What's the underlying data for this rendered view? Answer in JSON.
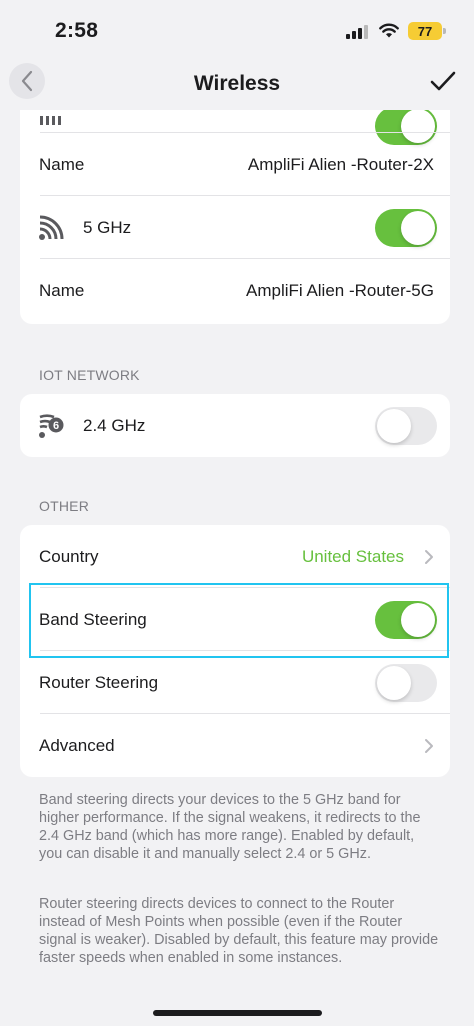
{
  "status_bar": {
    "time": "2:58",
    "battery": "77"
  },
  "nav": {
    "title": "Wireless"
  },
  "wifi_card": {
    "name_2g_label": "Name",
    "name_2g_value": "AmpliFi Alien -Router-2X",
    "band_5g_label": "5 GHz",
    "band_5g_on": true,
    "name_5g_label": "Name",
    "name_5g_value": "AmpliFi Alien -Router-5G"
  },
  "iot": {
    "header": "IOT NETWORK",
    "band_label": "2.4 GHz",
    "band_on": false
  },
  "other": {
    "header": "OTHER",
    "country_label": "Country",
    "country_value": "United States",
    "band_steering_label": "Band Steering",
    "band_steering_on": true,
    "router_steering_label": "Router Steering",
    "router_steering_on": false,
    "advanced_label": "Advanced"
  },
  "footer": {
    "band_steering_note": "Band steering directs your devices to the 5 GHz band for higher performance. If the signal weakens, it redirects to the 2.4 GHz band (which has more range). Enabled by default, you can disable it and manually select 2.4 or 5 GHz.",
    "router_steering_note": "Router steering directs devices to connect to the Router instead of Mesh Points when possible (even if the Router signal is weaker). Disabled by default, this feature may provide faster speeds when enabled in some instances."
  },
  "colors": {
    "accent": "#67c03e",
    "highlight": "#21c4f0",
    "background": "#f2f2f4"
  }
}
